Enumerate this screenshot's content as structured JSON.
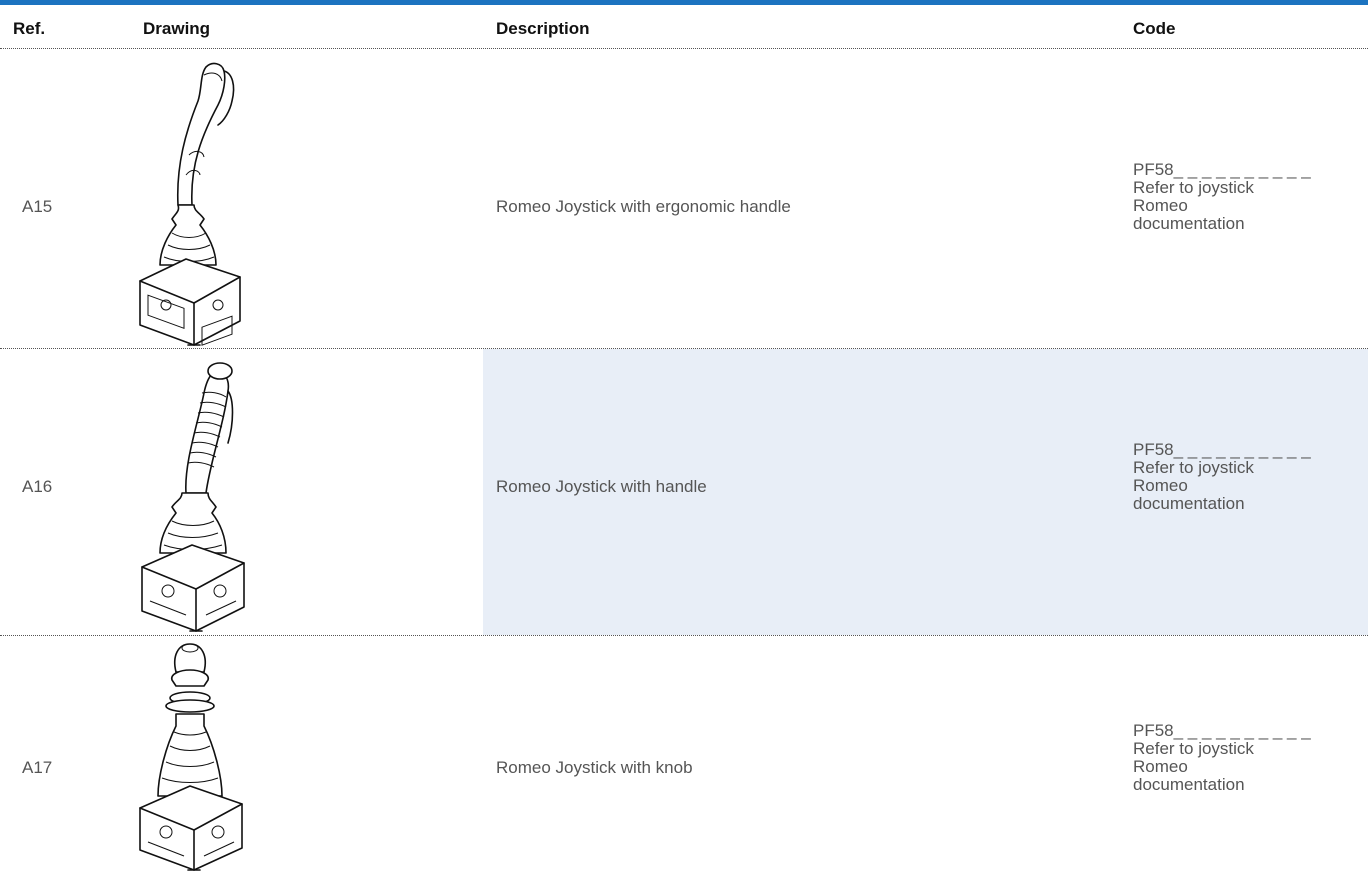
{
  "header": {
    "ref": "Ref.",
    "drawing": "Drawing",
    "description": "Description",
    "code": "Code"
  },
  "rows": [
    {
      "ref": "A15",
      "description": "Romeo Joystick with ergonomic handle",
      "code_lines": [
        "PF58_ _ _ _ _ _ _ _ _ _",
        "Refer to joystick",
        "Romeo",
        "documentation"
      ],
      "drawing_icon": "joystick-ergonomic-handle-icon"
    },
    {
      "ref": "A16",
      "description": "Romeo Joystick with handle",
      "code_lines": [
        "PF58_ _ _ _ _ _ _ _ _ _",
        "Refer to joystick",
        "Romeo",
        "documentation"
      ],
      "drawing_icon": "joystick-handle-icon"
    },
    {
      "ref": "A17",
      "description": "Romeo Joystick with knob",
      "code_lines": [
        "PF58_ _ _ _ _ _ _ _ _ _",
        "Refer to joystick",
        "Romeo",
        "documentation"
      ],
      "drawing_icon": "joystick-knob-icon"
    }
  ],
  "colors": {
    "top_bar": "#1c73c0",
    "highlight_cell": "#e8eef7",
    "text": "#555555"
  }
}
